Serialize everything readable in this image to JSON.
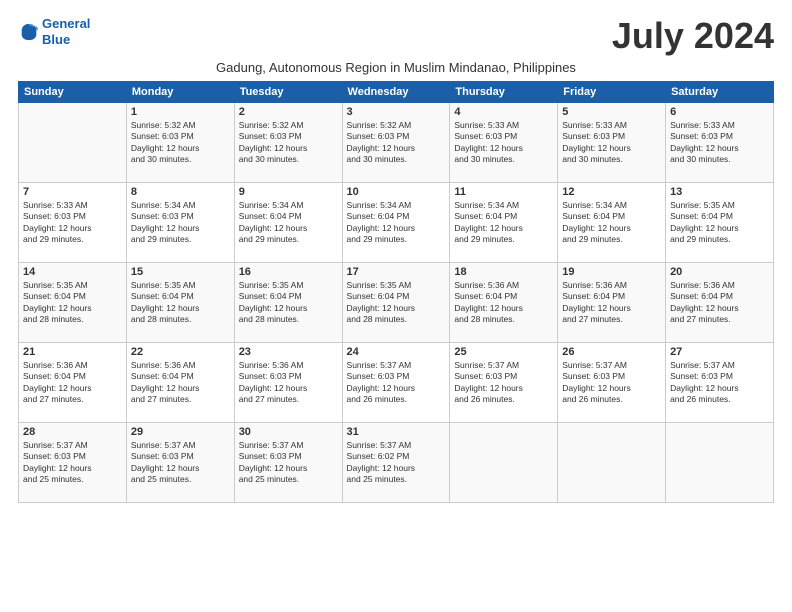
{
  "logo": {
    "line1": "General",
    "line2": "Blue"
  },
  "title": "July 2024",
  "subtitle": "Gadung, Autonomous Region in Muslim Mindanao, Philippines",
  "days_of_week": [
    "Sunday",
    "Monday",
    "Tuesday",
    "Wednesday",
    "Thursday",
    "Friday",
    "Saturday"
  ],
  "weeks": [
    [
      {
        "day": "",
        "info": ""
      },
      {
        "day": "1",
        "info": "Sunrise: 5:32 AM\nSunset: 6:03 PM\nDaylight: 12 hours\nand 30 minutes."
      },
      {
        "day": "2",
        "info": "Sunrise: 5:32 AM\nSunset: 6:03 PM\nDaylight: 12 hours\nand 30 minutes."
      },
      {
        "day": "3",
        "info": "Sunrise: 5:32 AM\nSunset: 6:03 PM\nDaylight: 12 hours\nand 30 minutes."
      },
      {
        "day": "4",
        "info": "Sunrise: 5:33 AM\nSunset: 6:03 PM\nDaylight: 12 hours\nand 30 minutes."
      },
      {
        "day": "5",
        "info": "Sunrise: 5:33 AM\nSunset: 6:03 PM\nDaylight: 12 hours\nand 30 minutes."
      },
      {
        "day": "6",
        "info": "Sunrise: 5:33 AM\nSunset: 6:03 PM\nDaylight: 12 hours\nand 30 minutes."
      }
    ],
    [
      {
        "day": "7",
        "info": "Sunrise: 5:33 AM\nSunset: 6:03 PM\nDaylight: 12 hours\nand 29 minutes."
      },
      {
        "day": "8",
        "info": "Sunrise: 5:34 AM\nSunset: 6:03 PM\nDaylight: 12 hours\nand 29 minutes."
      },
      {
        "day": "9",
        "info": "Sunrise: 5:34 AM\nSunset: 6:04 PM\nDaylight: 12 hours\nand 29 minutes."
      },
      {
        "day": "10",
        "info": "Sunrise: 5:34 AM\nSunset: 6:04 PM\nDaylight: 12 hours\nand 29 minutes."
      },
      {
        "day": "11",
        "info": "Sunrise: 5:34 AM\nSunset: 6:04 PM\nDaylight: 12 hours\nand 29 minutes."
      },
      {
        "day": "12",
        "info": "Sunrise: 5:34 AM\nSunset: 6:04 PM\nDaylight: 12 hours\nand 29 minutes."
      },
      {
        "day": "13",
        "info": "Sunrise: 5:35 AM\nSunset: 6:04 PM\nDaylight: 12 hours\nand 29 minutes."
      }
    ],
    [
      {
        "day": "14",
        "info": "Sunrise: 5:35 AM\nSunset: 6:04 PM\nDaylight: 12 hours\nand 28 minutes."
      },
      {
        "day": "15",
        "info": "Sunrise: 5:35 AM\nSunset: 6:04 PM\nDaylight: 12 hours\nand 28 minutes."
      },
      {
        "day": "16",
        "info": "Sunrise: 5:35 AM\nSunset: 6:04 PM\nDaylight: 12 hours\nand 28 minutes."
      },
      {
        "day": "17",
        "info": "Sunrise: 5:35 AM\nSunset: 6:04 PM\nDaylight: 12 hours\nand 28 minutes."
      },
      {
        "day": "18",
        "info": "Sunrise: 5:36 AM\nSunset: 6:04 PM\nDaylight: 12 hours\nand 28 minutes."
      },
      {
        "day": "19",
        "info": "Sunrise: 5:36 AM\nSunset: 6:04 PM\nDaylight: 12 hours\nand 27 minutes."
      },
      {
        "day": "20",
        "info": "Sunrise: 5:36 AM\nSunset: 6:04 PM\nDaylight: 12 hours\nand 27 minutes."
      }
    ],
    [
      {
        "day": "21",
        "info": "Sunrise: 5:36 AM\nSunset: 6:04 PM\nDaylight: 12 hours\nand 27 minutes."
      },
      {
        "day": "22",
        "info": "Sunrise: 5:36 AM\nSunset: 6:04 PM\nDaylight: 12 hours\nand 27 minutes."
      },
      {
        "day": "23",
        "info": "Sunrise: 5:36 AM\nSunset: 6:03 PM\nDaylight: 12 hours\nand 27 minutes."
      },
      {
        "day": "24",
        "info": "Sunrise: 5:37 AM\nSunset: 6:03 PM\nDaylight: 12 hours\nand 26 minutes."
      },
      {
        "day": "25",
        "info": "Sunrise: 5:37 AM\nSunset: 6:03 PM\nDaylight: 12 hours\nand 26 minutes."
      },
      {
        "day": "26",
        "info": "Sunrise: 5:37 AM\nSunset: 6:03 PM\nDaylight: 12 hours\nand 26 minutes."
      },
      {
        "day": "27",
        "info": "Sunrise: 5:37 AM\nSunset: 6:03 PM\nDaylight: 12 hours\nand 26 minutes."
      }
    ],
    [
      {
        "day": "28",
        "info": "Sunrise: 5:37 AM\nSunset: 6:03 PM\nDaylight: 12 hours\nand 25 minutes."
      },
      {
        "day": "29",
        "info": "Sunrise: 5:37 AM\nSunset: 6:03 PM\nDaylight: 12 hours\nand 25 minutes."
      },
      {
        "day": "30",
        "info": "Sunrise: 5:37 AM\nSunset: 6:03 PM\nDaylight: 12 hours\nand 25 minutes."
      },
      {
        "day": "31",
        "info": "Sunrise: 5:37 AM\nSunset: 6:02 PM\nDaylight: 12 hours\nand 25 minutes."
      },
      {
        "day": "",
        "info": ""
      },
      {
        "day": "",
        "info": ""
      },
      {
        "day": "",
        "info": ""
      }
    ]
  ]
}
